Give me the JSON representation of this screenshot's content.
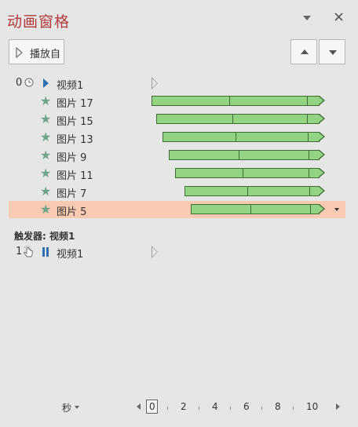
{
  "pane": {
    "title": "动画窗格",
    "menu_icon": "chevron-down-icon",
    "close_icon": "close-icon"
  },
  "toolbar": {
    "play_label": "播放自",
    "move_up_icon": "arrow-up-icon",
    "move_down_icon": "arrow-down-icon"
  },
  "animations": [
    {
      "index": "0",
      "icon": "clock-icon",
      "type_icon": "play-icon",
      "name": "视频1",
      "start": 0,
      "duration": 0
    },
    {
      "index": "",
      "icon": "star-icon",
      "name": "图片 17",
      "start": 0.0,
      "duration": 11.0
    },
    {
      "index": "",
      "icon": "star-icon",
      "name": "图片 15",
      "start": 0.3,
      "duration": 10.7
    },
    {
      "index": "",
      "icon": "star-icon",
      "name": "图片 13",
      "start": 0.7,
      "duration": 10.3
    },
    {
      "index": "",
      "icon": "star-icon",
      "name": "图片 9",
      "start": 1.1,
      "duration": 9.9
    },
    {
      "index": "",
      "icon": "star-icon",
      "name": "图片 11",
      "start": 1.5,
      "duration": 9.5
    },
    {
      "index": "",
      "icon": "star-icon",
      "name": "图片 7",
      "start": 2.1,
      "duration": 8.9
    },
    {
      "index": "",
      "icon": "star-icon",
      "name": "图片 5",
      "start": 2.5,
      "duration": 8.5,
      "selected": true
    }
  ],
  "trigger": {
    "heading": "触发器: 视频1",
    "index": "1",
    "icon": "mouse-click-icon",
    "type_icon": "pause-icon",
    "name": "视频1"
  },
  "timeline": {
    "unit": "秒",
    "ticks": [
      "0",
      "2",
      "4",
      "6",
      "8",
      "10"
    ]
  },
  "colors": {
    "title": "#b23b3b",
    "bar_fill": "#92d484",
    "selected_row": "#f9cab2",
    "star": "#6fa28a",
    "media_icon": "#2f6fb0"
  }
}
